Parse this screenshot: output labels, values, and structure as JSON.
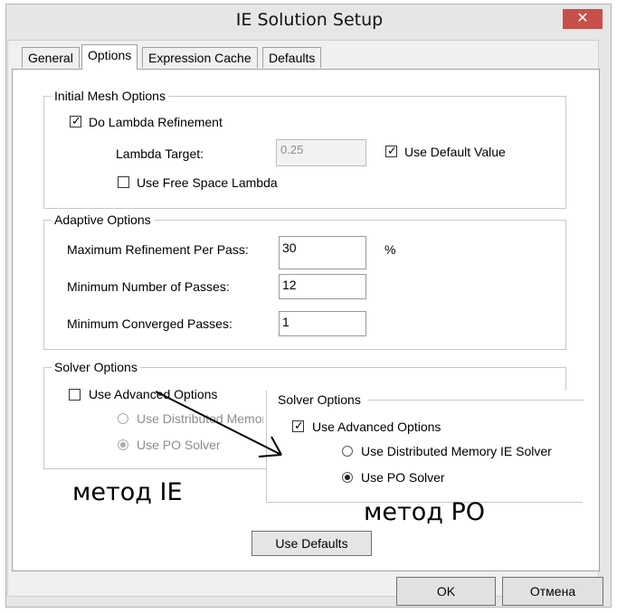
{
  "window": {
    "title": "IE Solution Setup",
    "close_glyph": "✕"
  },
  "tabs": [
    "General",
    "Options",
    "Expression Cache",
    "Defaults"
  ],
  "active_tab": "Options",
  "initial_mesh": {
    "group_label": "Initial Mesh Options",
    "do_lambda_refinement": {
      "label": "Do Lambda Refinement",
      "checked": true
    },
    "lambda_target": {
      "label": "Lambda Target:",
      "value": "0.25",
      "disabled": true
    },
    "use_default_value": {
      "label": "Use Default Value",
      "checked": true
    },
    "use_free_space_lambda": {
      "label": "Use Free Space Lambda",
      "checked": false
    }
  },
  "adaptive": {
    "group_label": "Adaptive Options",
    "max_refinement": {
      "label": "Maximum Refinement Per Pass:",
      "value": "30",
      "unit": "%"
    },
    "min_passes": {
      "label": "Minimum Number of Passes:",
      "value": "12"
    },
    "min_converged": {
      "label": "Minimum Converged Passes:",
      "value": "1"
    }
  },
  "solver_ie": {
    "group_label": "Solver Options",
    "use_advanced": {
      "label": "Use Advanced Options",
      "checked": false
    },
    "distributed": {
      "label": "Use Distributed Memory",
      "selected": false,
      "disabled": true
    },
    "po_solver": {
      "label": "Use PO Solver",
      "selected": true,
      "disabled": true
    },
    "annotation": "метод IE"
  },
  "solver_po": {
    "group_label": "Solver Options",
    "use_advanced": {
      "label": "Use Advanced Options",
      "checked": true
    },
    "distributed": {
      "label": "Use Distributed Memory IE Solver",
      "selected": false
    },
    "po_solver": {
      "label": "Use PO Solver",
      "selected": true
    },
    "annotation": "метод PO"
  },
  "buttons": {
    "use_defaults": "Use Defaults",
    "ok": "OK",
    "cancel": "Отмена"
  },
  "glyphs": {
    "check": "✓"
  },
  "colors": {
    "close_button": "#c7514a",
    "dialog_bg": "#f0f0f0",
    "panel_bg": "#ffffff"
  }
}
